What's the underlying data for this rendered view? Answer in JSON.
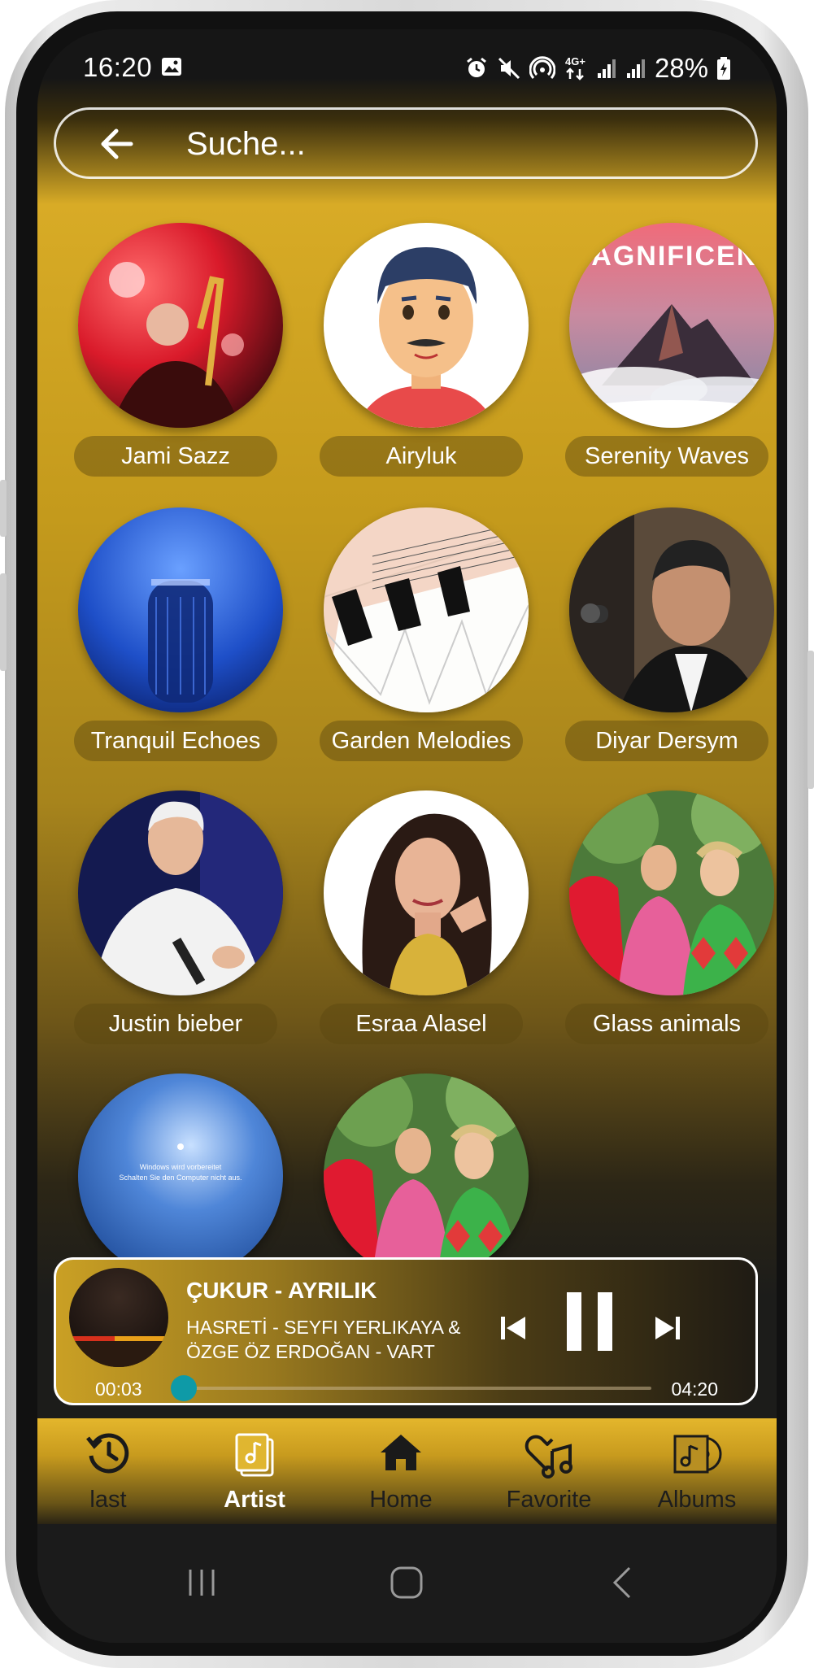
{
  "status_bar": {
    "time": "16:20",
    "battery": "28%"
  },
  "search": {
    "placeholder": "Suche..."
  },
  "artists": [
    {
      "name": "Jami Sazz"
    },
    {
      "name": "Airyluk"
    },
    {
      "name": "Serenity Waves",
      "art_text": "MAGNIFICENT"
    },
    {
      "name": "Tranquil Echoes"
    },
    {
      "name": "Garden Melodies"
    },
    {
      "name": "Diyar Dersym"
    },
    {
      "name": "Justin bieber"
    },
    {
      "name": "Esraa Alasel"
    },
    {
      "name": "Glass animals"
    },
    {
      "name": "",
      "art_text_line1": "Windows wird vorbereitet",
      "art_text_line2": "Schalten Sie den Computer nicht aus."
    },
    {
      "name": ""
    }
  ],
  "now_playing": {
    "title": "ÇUKUR - AYRILIK",
    "subtitle": "HASRETİ - SEYFI YERLIKAYA & ÖZGE ÖZ ERDOĞAN - VART",
    "current_time": "00:03",
    "total_time": "04:20",
    "progress": 0.012,
    "accent_color": "#0e9aa7"
  },
  "bottom_nav": [
    {
      "label": "last",
      "icon": "history-icon",
      "active": false
    },
    {
      "label": "Artist",
      "icon": "artist-cards-icon",
      "active": true
    },
    {
      "label": "Home",
      "icon": "home-icon",
      "active": false
    },
    {
      "label": "Favorite",
      "icon": "heart-music-icon",
      "active": false
    },
    {
      "label": "Albums",
      "icon": "album-icon",
      "active": false
    }
  ]
}
